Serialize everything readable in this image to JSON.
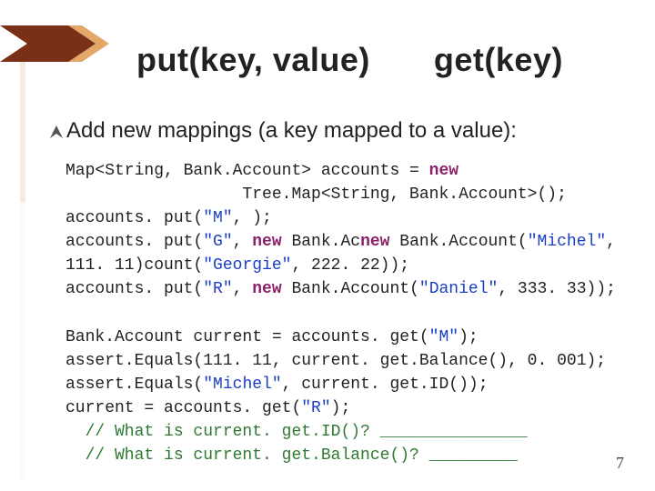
{
  "title": {
    "left": "put(key, value)",
    "right": "get(key)"
  },
  "subtitle": "Add new mappings (a key mapped to a value):",
  "code": {
    "l1a": "Map<String, Bank.Account> accounts = ",
    "l1b_kw": "new",
    "l2a": "                  Tree.Map<String, Bank.Account>();",
    "l3a": "accounts. put(",
    "l3b_str": "\"M\"",
    "l3c": ", );",
    "l4a": "accounts. put(",
    "l4b_str": "\"G\"",
    "l4c": ", ",
    "l4d_kw": "new",
    "l4e": " Bank.Ac",
    "l4f_kw": "new",
    "l4g": " Bank.Account(",
    "l4h_str": "\"Michel\"",
    "l4i": ",",
    "l5a": "111. 11)count(",
    "l5b_str": "\"Georgie\"",
    "l5c": ", 222. 22));",
    "l6a": "accounts. put(",
    "l6b_str": "\"R\"",
    "l6c": ", ",
    "l6d_kw": "new",
    "l6e": " Bank.Account(",
    "l6f_str": "\"Daniel\"",
    "l6g": ", 333. 33));",
    "l7a": "Bank.Account current = accounts. get(",
    "l7b_str": "\"M\"",
    "l7c": ");",
    "l8a": "assert.Equals(111. 11, current. get.Balance(), 0. 001);",
    "l9a": "assert.Equals(",
    "l9b_str": "\"Michel\"",
    "l9c": ", current. get.ID());",
    "l10a": "current = accounts. get(",
    "l10b_str": "\"R\"",
    "l10c": ");",
    "l11_cmt": "  // What is current. get.ID()? _______________",
    "l12_cmt": "  // What is current. get.Balance()? _________"
  },
  "page_number": "7",
  "icons": {
    "corner": "corner-accent",
    "arrow": "compass-arrow-icon"
  },
  "colors": {
    "accent_dark": "#7a3018",
    "accent_mid": "#c9782c",
    "keyword": "#8a1f68",
    "string": "#1a3fc2",
    "comment": "#2e7a33"
  }
}
